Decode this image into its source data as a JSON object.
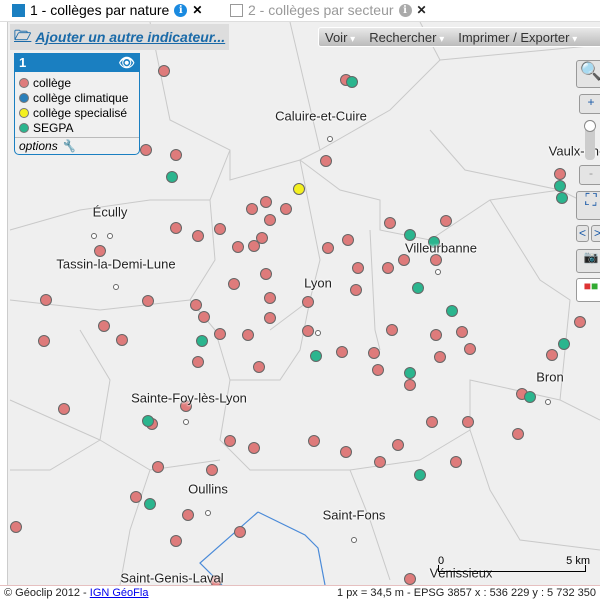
{
  "tabs": [
    {
      "label": "1 - collèges par nature",
      "active": true
    },
    {
      "label": "2 - collèges par secteur",
      "active": false
    }
  ],
  "add_indicator": "Ajouter un autre indicateur...",
  "legend": {
    "title": "1",
    "items": [
      {
        "label": "collège",
        "color": "#de7b7b"
      },
      {
        "label": "collège climatique",
        "color": "#2a7fba"
      },
      {
        "label": "collège specialisé",
        "color": "#f4f020"
      },
      {
        "label": "SEGPA",
        "color": "#2bb58e"
      }
    ],
    "options": "options"
  },
  "toolbar": {
    "view": "Voir",
    "search": "Rechercher",
    "print": "Imprimer / Exporter"
  },
  "places": [
    "Caluire-et-Cuire",
    "Écully",
    "Tassin-la-Demi-Lune",
    "Villeurbanne",
    "Lyon",
    "Sainte-Foy-lès-Lyon",
    "Bron",
    "Oullins",
    "Saint-Fons",
    "Saint-Genis-Laval",
    "Vénissieux",
    "Vaulx-en-"
  ],
  "scale": {
    "zero": "0",
    "max": "5 km"
  },
  "footer": {
    "copyright": "© Géoclip 2012 - ",
    "link": "IGN GéoFla",
    "coords": "1 px = 34,5 m - EPSG 3857  x : 536 229   y : 5 732 350"
  },
  "controls": {
    "zoom_in": "+",
    "zoom_out": "-",
    "prev": "<",
    "next": ">"
  }
}
